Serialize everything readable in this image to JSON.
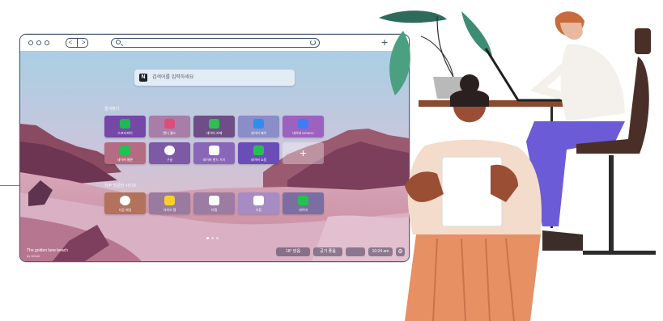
{
  "browser": {
    "nav_back": "<",
    "nav_forward": ">",
    "new_tab": "+"
  },
  "newtab": {
    "search_placeholder": "검색어를 입력하세요",
    "logo_letter": "N",
    "section_favorites": "즐겨찾기",
    "section_frequent": "자주 방문한 사이트",
    "favorites": [
      {
        "label": "스포티파이",
        "bg": "#7548a8",
        "icon": "#1db954"
      },
      {
        "label": "캔디 월드",
        "bg": "#a87ea8",
        "icon": "#e04c7a"
      },
      {
        "label": "네이버 카페",
        "bg": "#6f4d86",
        "icon": "#2fbf4f"
      },
      {
        "label": "네이버 페이",
        "bg": "#8a8dc8",
        "icon": "#2d8ff0"
      },
      {
        "label": "네이버 MYBOX",
        "bg": "#9d62c0",
        "icon": "#3d7df5"
      },
      {
        "label": "네이버 웹툰",
        "bg": "#b46b83",
        "icon": "#21c251"
      },
      {
        "label": "구글",
        "bg": "#7d5aa8",
        "icon": "#ffffff"
      },
      {
        "label": "네이버 밴드 가기",
        "bg": "#8a66b8",
        "icon": "#1e1e1e"
      },
      {
        "label": "네이버 쇼핑",
        "bg": "#6b4db8",
        "icon": "#23c24f"
      }
    ],
    "add_label": "+",
    "frequent": [
      {
        "label": "다음 메일",
        "bg": "#b2725c",
        "icon": "#ffffff",
        "glyph": "D"
      },
      {
        "label": "카카오 맵",
        "bg": "#9a7a9e",
        "icon": "#f7d12a",
        "glyph": "K"
      },
      {
        "label": "티맵",
        "bg": "#9c7ca2",
        "icon": "#ffffff",
        "glyph": "T"
      },
      {
        "label": "다음",
        "bg": "#a68cc2",
        "icon": "#ffffff",
        "glyph": "D"
      },
      {
        "label": "네이버",
        "bg": "#7b6ea2",
        "icon": "#23c24f",
        "glyph": "N"
      }
    ],
    "photo_title": "The golden lune beach",
    "photo_credit": "by Whale",
    "status_weather": "18° 맑음",
    "status_air": "공기 좋음",
    "status_time": "10:24 am",
    "colors": {
      "accent": "#7548a8",
      "sky_top": "#a9cfe4",
      "sky_bottom": "#e7b9c0"
    }
  }
}
